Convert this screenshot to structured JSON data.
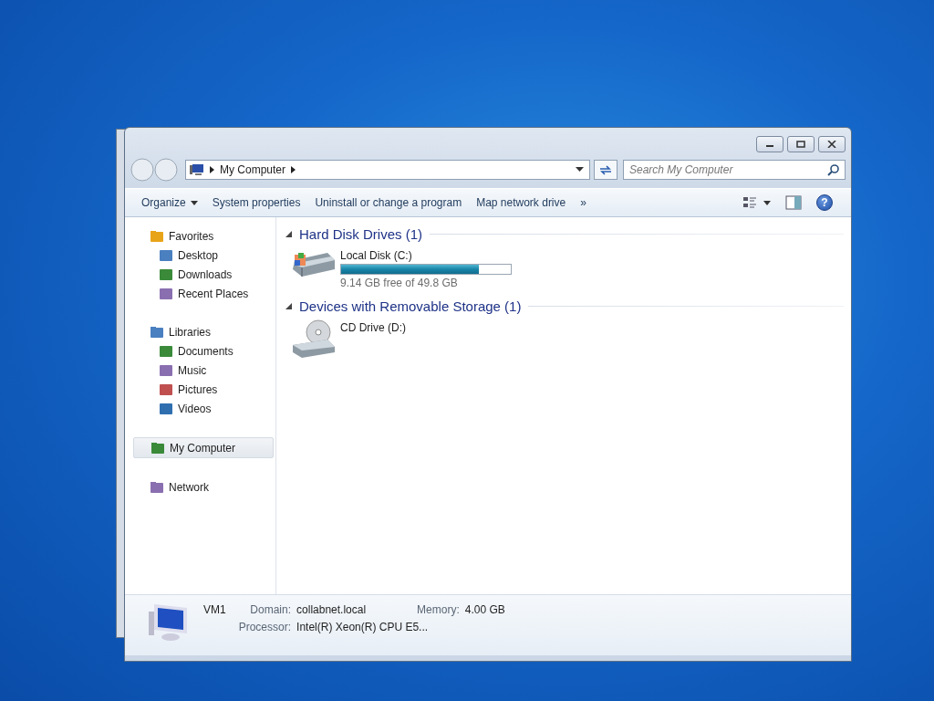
{
  "address": {
    "path": "My Computer"
  },
  "search": {
    "placeholder": "Search My Computer"
  },
  "toolbar": {
    "items": [
      "Organize",
      "System properties",
      "Uninstall or change a program",
      "Map network drive"
    ],
    "more": "»",
    "help": "?"
  },
  "sidebar": {
    "items": [
      {
        "label": "Favorites",
        "selected": false,
        "children": [
          {
            "label": "Desktop",
            "selected": false
          },
          {
            "label": "Downloads",
            "selected": false
          },
          {
            "label": "Recent Places",
            "selected": false
          }
        ]
      },
      {
        "label": "Libraries",
        "selected": false,
        "children": [
          {
            "label": "Documents",
            "selected": false
          },
          {
            "label": "Music",
            "selected": false
          },
          {
            "label": "Pictures",
            "selected": false
          },
          {
            "label": "Videos",
            "selected": false
          }
        ]
      },
      {
        "label": "My Computer",
        "selected": true
      },
      {
        "label": "Network",
        "selected": false
      }
    ]
  },
  "groups": [
    {
      "title": "Hard Disk Drives (1)",
      "items": [
        {
          "kind": "disk",
          "name": "Local Disk (C:)",
          "level": 0.81,
          "info": "9.14 GB free of 49.8 GB"
        }
      ]
    },
    {
      "title": "Devices with Removable Storage (1)",
      "items": [
        {
          "kind": "cd",
          "name": "CD Drive (D:)"
        }
      ]
    }
  ],
  "details": {
    "name": "VM1",
    "fields": [
      {
        "label": "Domain:",
        "value": "collabnet.local"
      },
      {
        "label": "Memory:",
        "value": "4.00 GB"
      },
      {
        "label": "Processor:",
        "value": "Intel(R) Xeon(R) CPU E5..."
      }
    ]
  }
}
